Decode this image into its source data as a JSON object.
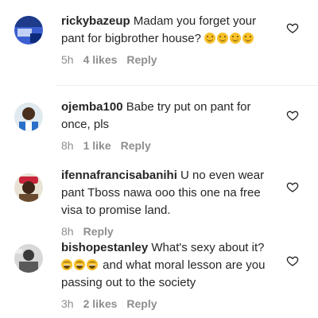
{
  "colors": {
    "text": "#262626",
    "meta": "#8e8e8e",
    "emoji": "#f7c02a"
  },
  "comments": [
    {
      "username": "rickybazeup",
      "text": "Madam you forget your pant for bigbrother house?",
      "emoji": [
        "smile-emoji",
        "smile-emoji",
        "smile-emoji",
        "smile-emoji"
      ],
      "time": "5h",
      "likes": "4 likes",
      "reply": "Reply"
    },
    {
      "username": "ojemba100",
      "text": "Babe try put on pant for once, pls",
      "time": "8h",
      "likes": "1 like",
      "reply": "Reply"
    },
    {
      "username": "ifennafrancisabanihi",
      "text": "U no even wear pant Tboss nawa ooo this one na free visa to promise land.",
      "time": "8h",
      "reply": "Reply"
    },
    {
      "username": "bishopestanley",
      "text_before": "What's sexy about it?",
      "emoji": [
        "laughing-emoji",
        "laughing-emoji",
        "laughing-emoji"
      ],
      "text_after": "and what moral lesson are you passing out to the society",
      "time": "3h",
      "likes": "2 likes",
      "reply": "Reply"
    }
  ]
}
